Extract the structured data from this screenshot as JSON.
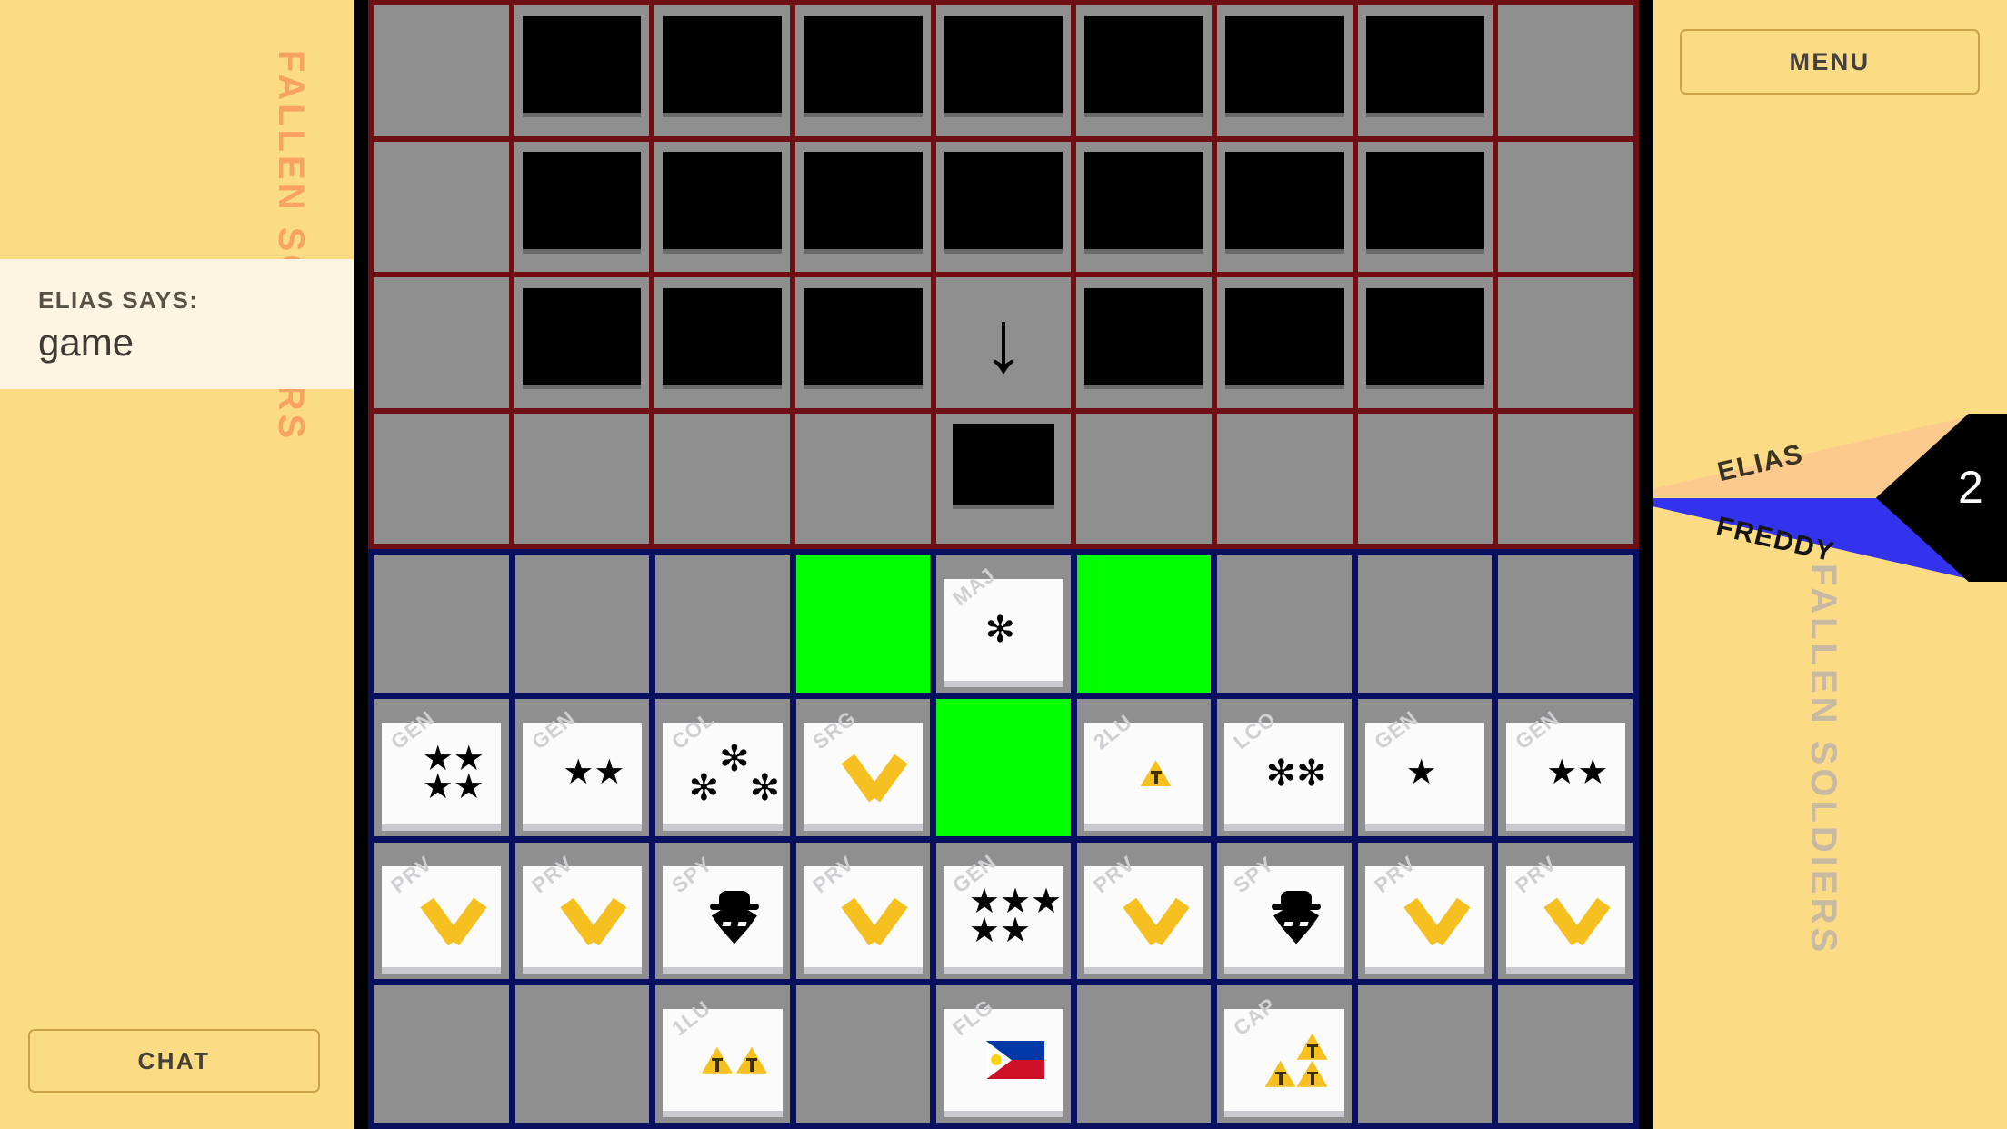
{
  "left": {
    "fallen_label": "FALLEN SOLDIERS",
    "chat": {
      "says_label": "ELIAS SAYS:",
      "message": "game"
    },
    "chat_button": "CHAT"
  },
  "right": {
    "menu_button": "MENU",
    "fallen_label": "FALLEN SOLDIERS",
    "turn": {
      "player_top": "ELIAS",
      "player_bottom": "FREDDY",
      "count": "2"
    }
  },
  "colors": {
    "background": "#fbdc85",
    "board_border": "#000000",
    "enemy_grid_line": "#6d0f13",
    "own_grid_line": "#0a1060",
    "cell": "#8f8f8f",
    "highlight": "#00ff00",
    "tile": "#fbfbfb",
    "insignia_gold": "#f5c020",
    "elias_color": "#fbca8c",
    "freddy_color": "#3333ee"
  },
  "board": {
    "columns": 9,
    "enemy_rows": [
      [
        {
          "type": "blank"
        },
        {
          "type": "hidden"
        },
        {
          "type": "hidden"
        },
        {
          "type": "hidden"
        },
        {
          "type": "hidden"
        },
        {
          "type": "hidden"
        },
        {
          "type": "hidden"
        },
        {
          "type": "hidden"
        },
        {
          "type": "blank"
        }
      ],
      [
        {
          "type": "blank"
        },
        {
          "type": "hidden"
        },
        {
          "type": "hidden"
        },
        {
          "type": "hidden"
        },
        {
          "type": "hidden"
        },
        {
          "type": "hidden"
        },
        {
          "type": "hidden"
        },
        {
          "type": "hidden"
        },
        {
          "type": "blank"
        }
      ],
      [
        {
          "type": "blank"
        },
        {
          "type": "hidden"
        },
        {
          "type": "hidden"
        },
        {
          "type": "hidden"
        },
        {
          "type": "arrow",
          "glyph": "↓"
        },
        {
          "type": "hidden"
        },
        {
          "type": "hidden"
        },
        {
          "type": "hidden"
        },
        {
          "type": "blank"
        }
      ],
      [
        {
          "type": "blank"
        },
        {
          "type": "blank"
        },
        {
          "type": "blank"
        },
        {
          "type": "blank"
        },
        {
          "type": "hidden-small"
        },
        {
          "type": "blank"
        },
        {
          "type": "blank"
        },
        {
          "type": "blank"
        },
        {
          "type": "blank"
        }
      ]
    ],
    "own_rows": [
      [
        {
          "type": "blank"
        },
        {
          "type": "blank"
        },
        {
          "type": "blank"
        },
        {
          "type": "green"
        },
        {
          "type": "piece",
          "rank": "MAJ",
          "symbol": "burst",
          "count": 1
        },
        {
          "type": "green"
        },
        {
          "type": "blank"
        },
        {
          "type": "blank"
        },
        {
          "type": "blank"
        }
      ],
      [
        {
          "type": "piece",
          "rank": "GEN",
          "symbol": "star",
          "count": 4
        },
        {
          "type": "piece",
          "rank": "GEN",
          "symbol": "star",
          "count": 2
        },
        {
          "type": "piece",
          "rank": "COL",
          "symbol": "burst",
          "count": 3
        },
        {
          "type": "piece",
          "rank": "SRG",
          "symbol": "chevron",
          "count": 1
        },
        {
          "type": "green"
        },
        {
          "type": "piece",
          "rank": "2LU",
          "symbol": "bar",
          "count": 1
        },
        {
          "type": "piece",
          "rank": "LCO",
          "symbol": "burst",
          "count": 2
        },
        {
          "type": "piece",
          "rank": "GEN",
          "symbol": "star",
          "count": 1
        },
        {
          "type": "piece",
          "rank": "GEN",
          "symbol": "star",
          "count": 2
        }
      ],
      [
        {
          "type": "piece",
          "rank": "PRV",
          "symbol": "chevron",
          "count": 1
        },
        {
          "type": "piece",
          "rank": "PRV",
          "symbol": "chevron",
          "count": 1
        },
        {
          "type": "piece",
          "rank": "SPY",
          "symbol": "spy",
          "count": 1
        },
        {
          "type": "piece",
          "rank": "PRV",
          "symbol": "chevron",
          "count": 1
        },
        {
          "type": "piece",
          "rank": "GEN",
          "symbol": "star",
          "count": 5
        },
        {
          "type": "piece",
          "rank": "PRV",
          "symbol": "chevron",
          "count": 1
        },
        {
          "type": "piece",
          "rank": "SPY",
          "symbol": "spy",
          "count": 1
        },
        {
          "type": "piece",
          "rank": "PRV",
          "symbol": "chevron",
          "count": 1
        },
        {
          "type": "piece",
          "rank": "PRV",
          "symbol": "chevron",
          "count": 1
        }
      ],
      [
        {
          "type": "blank"
        },
        {
          "type": "blank"
        },
        {
          "type": "piece",
          "rank": "1LU",
          "symbol": "bar",
          "count": 2
        },
        {
          "type": "blank"
        },
        {
          "type": "piece",
          "rank": "FLG",
          "symbol": "flag",
          "count": 1
        },
        {
          "type": "blank"
        },
        {
          "type": "piece",
          "rank": "CAP",
          "symbol": "bar",
          "count": 3
        },
        {
          "type": "blank"
        },
        {
          "type": "blank"
        }
      ]
    ]
  }
}
